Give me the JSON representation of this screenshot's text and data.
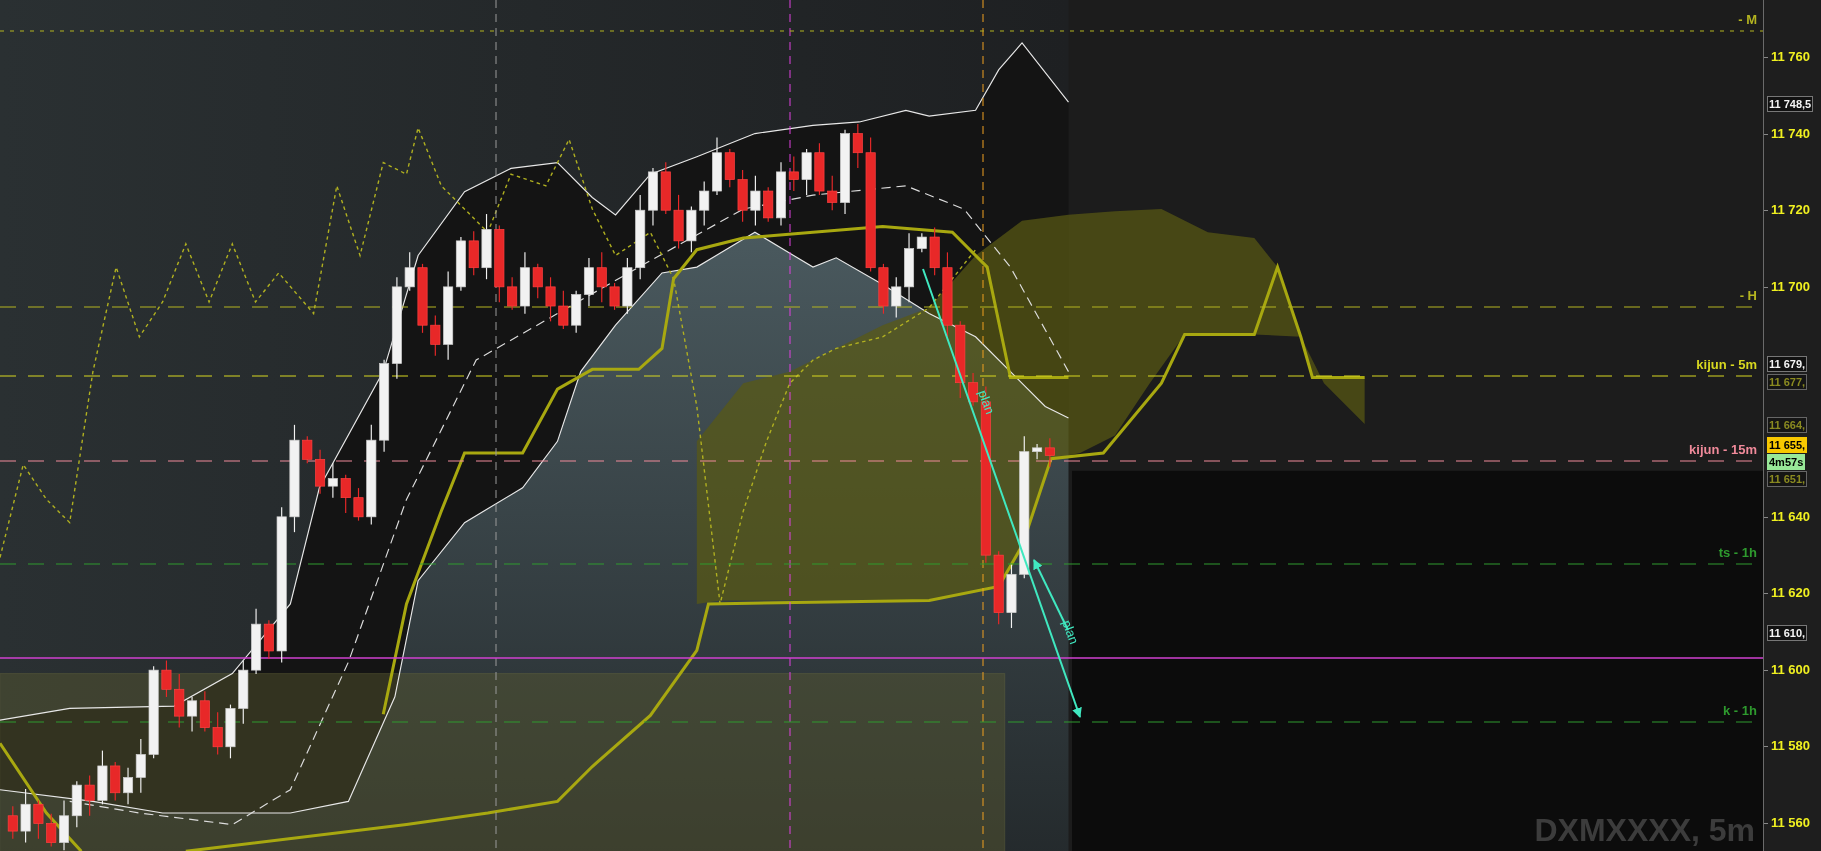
{
  "chart": {
    "symbol_label": "DXMXXXX, 5m",
    "level_lines": [
      {
        "label": "- M",
        "color": "#b4b420"
      },
      {
        "label": "- H",
        "color": "#b4b420"
      },
      {
        "label": "kijun - 5m",
        "color": "#d8d820"
      },
      {
        "label": "kijun - 15m",
        "color": "#f08a9a"
      },
      {
        "label": "ts - 1h",
        "color": "#2e9a2e"
      },
      {
        "label": "k - 1h",
        "color": "#2e9a2e"
      }
    ],
    "annotations": [
      {
        "text": "plan"
      },
      {
        "text": "plan"
      }
    ],
    "price_axis": {
      "ticks": [
        "11 760",
        "11 740",
        "11 720",
        "11 700",
        "11 640",
        "11 620",
        "11 600",
        "11 580",
        "11 560"
      ],
      "tags": [
        {
          "text": "11 748,5",
          "kind": "plain"
        },
        {
          "text": "11 679,",
          "kind": "plain"
        },
        {
          "text": "11 677,",
          "kind": "faded"
        },
        {
          "text": "11 664,",
          "kind": "faded"
        },
        {
          "text": "11 655,",
          "kind": "highlight"
        },
        {
          "text": "4m57s",
          "kind": "timer"
        },
        {
          "text": "11 651,",
          "kind": "faded"
        },
        {
          "text": "11 610,",
          "kind": "plain"
        }
      ]
    }
  }
}
